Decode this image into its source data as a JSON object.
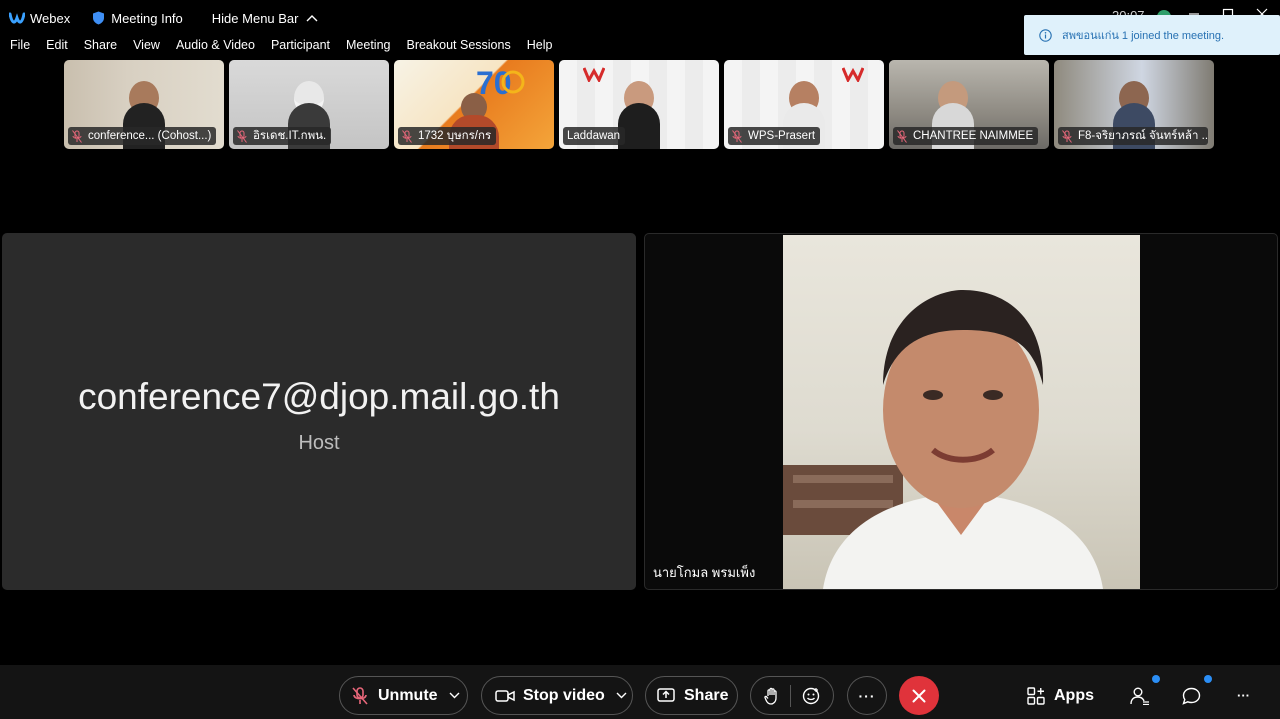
{
  "titlebar": {
    "app_name": "Webex",
    "meeting_info": "Meeting Info",
    "hide_menu": "Hide Menu Bar",
    "clock": "20:07"
  },
  "menubar": [
    "File",
    "Edit",
    "Share",
    "View",
    "Audio & Video",
    "Participant",
    "Meeting",
    "Breakout Sessions",
    "Help"
  ],
  "notification": "สพขอนแก่น 1 joined the meeting.",
  "thumbnails": [
    {
      "label": "conference... (Cohost...)"
    },
    {
      "label": "อิรเดช.IT.กพน."
    },
    {
      "label": "1732 บุษกร/กร"
    },
    {
      "label": "Laddawan"
    },
    {
      "label": "WPS-Prasert"
    },
    {
      "label": "CHANTREE NAIMMEE"
    },
    {
      "label": "F8-จริยาภรณ์ จันทร์หล้า ..."
    }
  ],
  "stage": {
    "host_name": "conference7@djop.mail.go.th",
    "host_role": "Host",
    "speaker_name": "นายโกมล พรมเพ็ง"
  },
  "controls": {
    "unmute": "Unmute",
    "stop_video": "Stop video",
    "share": "Share",
    "more": "···",
    "apps": "Apps",
    "overflow": "···"
  },
  "colors": {
    "end_call": "#e0333b",
    "toast_bg": "#dff1fb",
    "toast_text": "#2872b3",
    "badge": "#2b8ef5",
    "muted_mic": "#e8677a"
  }
}
